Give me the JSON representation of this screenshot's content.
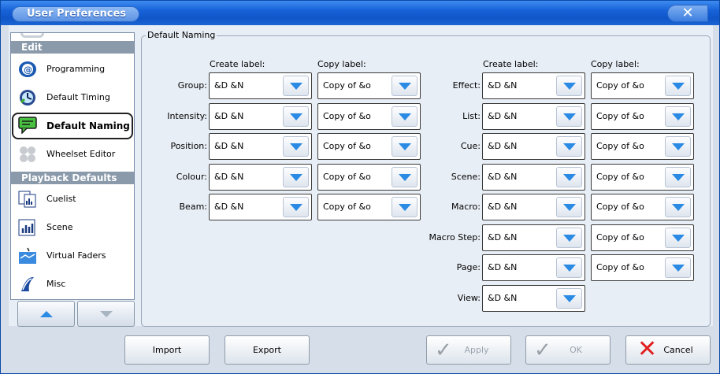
{
  "window": {
    "title": "User Preferences",
    "close_glyph": "✕"
  },
  "sidebar": {
    "sections": [
      {
        "label": "Edit"
      },
      {
        "label": "Playback Defaults"
      }
    ],
    "items": [
      {
        "label": "Programming",
        "icon": "programming-icon"
      },
      {
        "label": "Default Timing",
        "icon": "timing-icon"
      },
      {
        "label": "Default Naming",
        "icon": "naming-icon",
        "active": true
      },
      {
        "label": "Wheelset Editor",
        "icon": "wheelset-icon"
      },
      {
        "label": "Cuelist",
        "icon": "cuelist-icon"
      },
      {
        "label": "Scene",
        "icon": "scene-icon"
      },
      {
        "label": "Virtual Faders",
        "icon": "faders-icon"
      },
      {
        "label": "Misc",
        "icon": "misc-icon"
      }
    ]
  },
  "group": {
    "title": "Default Naming",
    "create_label": "Create label:",
    "copy_label": "Copy label:"
  },
  "left_rows": [
    {
      "label": "Group:",
      "create": "&D &N",
      "copy": "Copy of &o"
    },
    {
      "label": "Intensity:",
      "create": "&D &N",
      "copy": "Copy of &o"
    },
    {
      "label": "Position:",
      "create": "&D &N",
      "copy": "Copy of &o"
    },
    {
      "label": "Colour:",
      "create": "&D &N",
      "copy": "Copy of &o"
    },
    {
      "label": "Beam:",
      "create": "&D &N",
      "copy": "Copy of &o"
    }
  ],
  "right_rows": [
    {
      "label": "Effect:",
      "create": "&D &N",
      "copy": "Copy of &o"
    },
    {
      "label": "List:",
      "create": "&D &N",
      "copy": "Copy of &o"
    },
    {
      "label": "Cue:",
      "create": "&D &N",
      "copy": "Copy of &o"
    },
    {
      "label": "Scene:",
      "create": "&D &N",
      "copy": "Copy of &o"
    },
    {
      "label": "Macro:",
      "create": "&D &N",
      "copy": "Copy of &o"
    },
    {
      "label": "Macro Step:",
      "create": "&D &N",
      "copy": "Copy of &o"
    },
    {
      "label": "Page:",
      "create": "&D &N",
      "copy": "Copy of &o"
    },
    {
      "label": "View:",
      "create": "&D &N"
    }
  ],
  "buttons": {
    "import": "Import",
    "export": "Export",
    "apply": "Apply",
    "ok": "OK",
    "cancel": "Cancel"
  },
  "colors": {
    "title_bar": "#1762d8",
    "dropdown_arrow": "#2a8ae4",
    "cancel_icon": "#e02020"
  }
}
